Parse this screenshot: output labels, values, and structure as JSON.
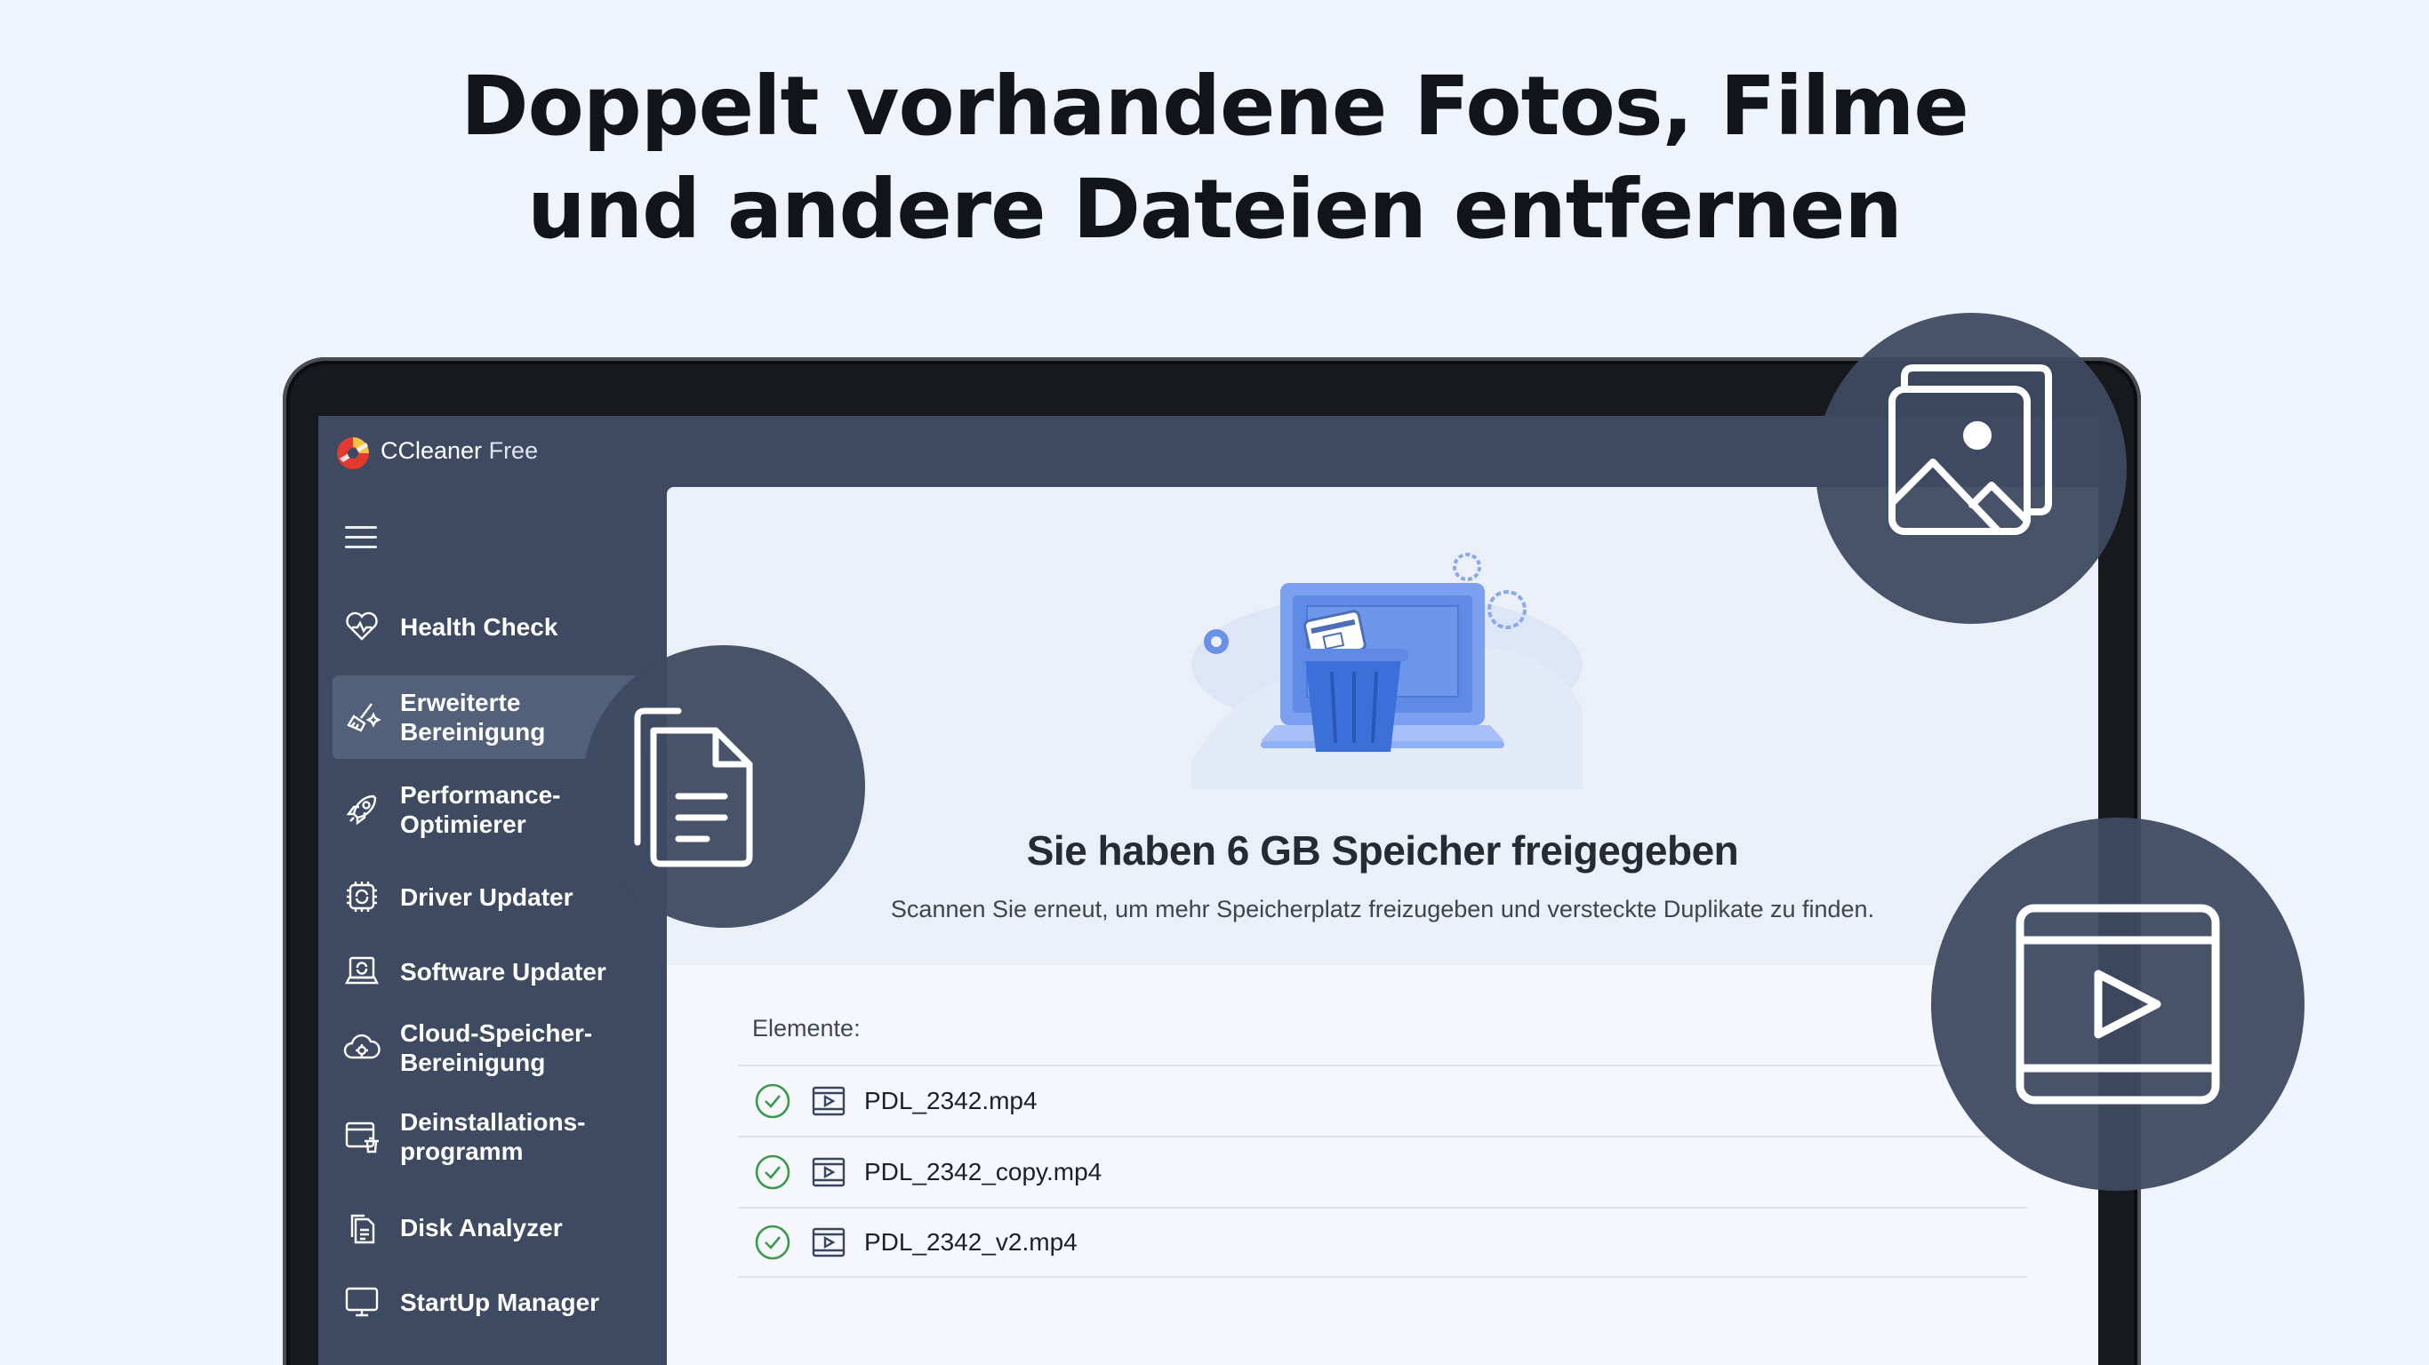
{
  "headline": {
    "line1": "Doppelt vorhandene Fotos, Filme",
    "line2": "und andere Dateien entfernen"
  },
  "app": {
    "name": "CCleaner",
    "edition": "Free"
  },
  "sidebar": {
    "items": [
      {
        "label": "Health Check",
        "icon": "heart-icon",
        "active": false
      },
      {
        "label": "Erweiterte Bereinigung",
        "icon": "broom-sparkle-icon",
        "active": true
      },
      {
        "label": "Performance-Optimierer",
        "icon": "rocket-icon",
        "active": false
      },
      {
        "label": "Driver Updater",
        "icon": "chip-refresh-icon",
        "active": false
      },
      {
        "label": "Software Updater",
        "icon": "laptop-refresh-icon",
        "active": false
      },
      {
        "label": "Cloud-Speicher-Bereinigung",
        "icon": "cloud-gear-icon",
        "active": false
      },
      {
        "label": "Deinstallations-programm",
        "icon": "uninstall-icon",
        "active": false
      },
      {
        "label": "Disk Analyzer",
        "icon": "document-stack-icon",
        "active": false
      },
      {
        "label": "StartUp Manager",
        "icon": "monitor-icon",
        "active": false
      }
    ]
  },
  "result": {
    "title": "Sie haben 6 GB Speicher freigegeben",
    "subtitle": "Scannen Sie erneut, um mehr Speicherplatz freizugeben und versteckte Duplikate zu finden."
  },
  "list": {
    "label": "Elemente:",
    "files": [
      {
        "name": "PDL_2342.mp4",
        "status": "check-icon",
        "type": "video-file-icon"
      },
      {
        "name": "PDL_2342_copy.mp4",
        "status": "check-icon",
        "type": "video-file-icon"
      },
      {
        "name": "PDL_2342_v2.mp4",
        "status": "check-icon",
        "type": "video-file-icon"
      }
    ]
  },
  "colors": {
    "sidebar_bg": "#3e4a61",
    "active_item": "#536079",
    "content_bg": "#eaeff8",
    "check_green": "#3a9a4a",
    "accent_blue": "#5b8def"
  }
}
